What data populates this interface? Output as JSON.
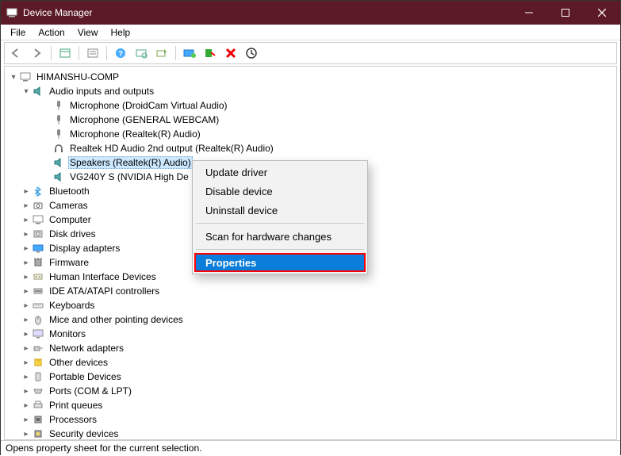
{
  "window": {
    "title": "Device Manager"
  },
  "menu": [
    "File",
    "Action",
    "View",
    "Help"
  ],
  "tree": {
    "root": "HIMANSHU-COMP",
    "audio": {
      "label": "Audio inputs and outputs",
      "children": [
        "Microphone (DroidCam Virtual Audio)",
        "Microphone (GENERAL WEBCAM)",
        "Microphone (Realtek(R) Audio)",
        "Realtek HD Audio 2nd output (Realtek(R) Audio)",
        "Speakers (Realtek(R) Audio)",
        "VG240Y S (NVIDIA High De"
      ]
    },
    "categories": [
      "Bluetooth",
      "Cameras",
      "Computer",
      "Disk drives",
      "Display adapters",
      "Firmware",
      "Human Interface Devices",
      "IDE ATA/ATAPI controllers",
      "Keyboards",
      "Mice and other pointing devices",
      "Monitors",
      "Network adapters",
      "Other devices",
      "Portable Devices",
      "Ports (COM & LPT)",
      "Print queues",
      "Processors",
      "Security devices"
    ]
  },
  "context": {
    "update": "Update driver",
    "disable": "Disable device",
    "uninstall": "Uninstall device",
    "scan": "Scan for hardware changes",
    "properties": "Properties"
  },
  "status": "Opens property sheet for the current selection."
}
